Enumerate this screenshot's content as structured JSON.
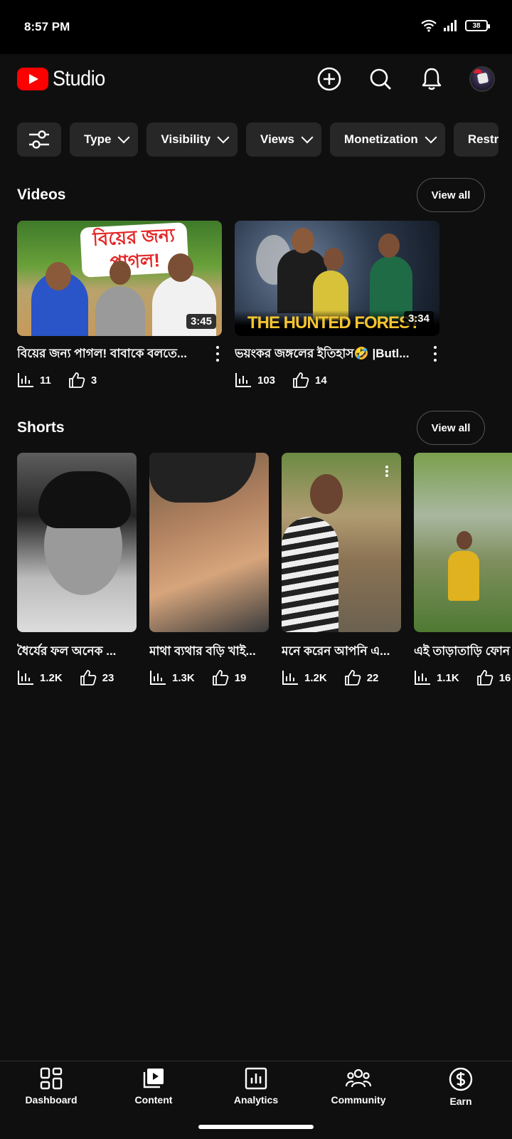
{
  "status_bar": {
    "time": "8:57 PM",
    "battery": "38"
  },
  "header": {
    "logo_text": "Studio"
  },
  "filters": [
    "Type",
    "Visibility",
    "Views",
    "Monetization",
    "Restr"
  ],
  "videos_section": {
    "title": "Videos",
    "view_all_label": "View all",
    "items": [
      {
        "title": "বিয়ের জন্য পাগল! বাবাকে বলতে...",
        "duration": "3:45",
        "views": "11",
        "likes": "3",
        "thumb_text": "বিয়ের জন্য পাগল!"
      },
      {
        "title": "ভয়ংকর জঙ্গলের ইতিহাস🤣 |Butl...",
        "duration": "3:34",
        "views": "103",
        "likes": "14",
        "thumb_text": "THE HUNTED FOREST"
      }
    ]
  },
  "shorts_section": {
    "title": "Shorts",
    "view_all_label": "View all",
    "items": [
      {
        "title": "ধৈর্যের ফল অনেক ...",
        "views": "1.2K",
        "likes": "23"
      },
      {
        "title": "মাথা ব্যথার বড়ি খাই...",
        "views": "1.3K",
        "likes": "19"
      },
      {
        "title": "মনে করেন আপনি এ...",
        "views": "1.2K",
        "likes": "22"
      },
      {
        "title": "এই তাড়াতাড়ি ফোন",
        "views": "1.1K",
        "likes": "16"
      }
    ]
  },
  "bottom_nav": [
    "Dashboard",
    "Content",
    "Analytics",
    "Community",
    "Earn"
  ]
}
